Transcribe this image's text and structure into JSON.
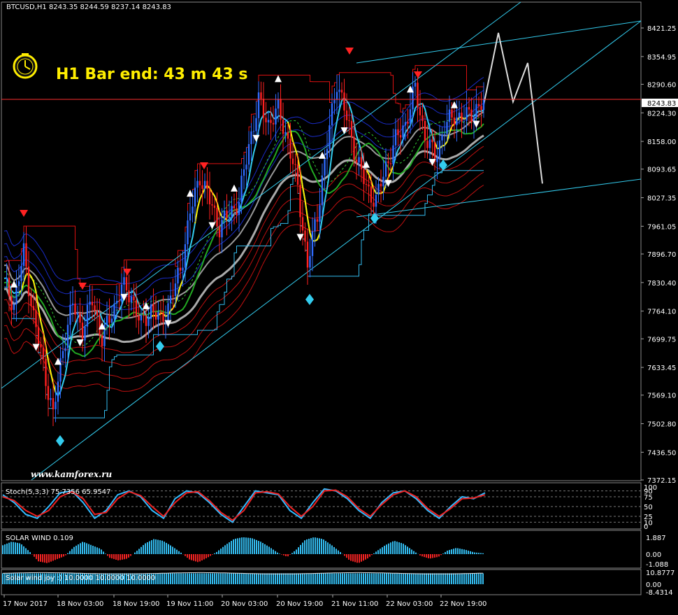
{
  "symbol_header": "BTCUSD,H1  8243.35 8244.59 8237.14 8243.83",
  "timer_text": "H1 Bar end: 43 m 43 s",
  "watermark": "www.kamforex.ru",
  "current_price_label": "8243.83",
  "colors": {
    "background": "#000000",
    "bull": "#2f6bff",
    "bear": "#ff2020",
    "yellow": "#ffee00",
    "cyan": "#33ccee",
    "grid": "#555555"
  },
  "price_axis": [
    "8421.25",
    "8354.95",
    "8290.60",
    "8224.30",
    "8158.00",
    "8093.65",
    "8027.35",
    "7961.05",
    "7896.70",
    "7830.40",
    "7764.10",
    "7699.75",
    "7633.45",
    "7569.10",
    "7502.80",
    "7436.50",
    "7372.15"
  ],
  "time_axis": [
    "17 Nov 2017",
    "18 Nov 03:00",
    "18 Nov 19:00",
    "19 Nov 11:00",
    "20 Nov 03:00",
    "20 Nov 19:00",
    "21 Nov 11:00",
    "22 Nov 03:00",
    "22 Nov 19:00"
  ],
  "stoch": {
    "label": "Stoch(5,3,3) 75.7356 65.9547",
    "levels": [
      "100",
      "90",
      "75",
      "50",
      "25",
      "10",
      "0"
    ]
  },
  "solar": {
    "label": "SOLAR WIND 0.109",
    "levels": [
      "1.887",
      "0.00",
      "-1.088"
    ]
  },
  "joy": {
    "label": "Solar wind joy :) 10.0000 10.0000 10.0000",
    "levels": [
      "10.8777",
      "0.00",
      "-8.4314"
    ]
  },
  "chart_data": {
    "type": "candlestick",
    "symbol": "BTCUSD",
    "timeframe": "H1",
    "ohlc_last": {
      "open": 8243.35,
      "high": 8244.59,
      "low": 8237.14,
      "close": 8243.83
    },
    "ylim": [
      7372.15,
      8421.25
    ],
    "close_path": [
      [
        0,
        7830
      ],
      [
        4,
        7780
      ],
      [
        8,
        7900
      ],
      [
        12,
        7750
      ],
      [
        16,
        7640
      ],
      [
        20,
        7520
      ],
      [
        24,
        7680
      ],
      [
        28,
        7780
      ],
      [
        32,
        7720
      ],
      [
        36,
        7790
      ],
      [
        40,
        7700
      ],
      [
        44,
        7760
      ],
      [
        48,
        7820
      ],
      [
        52,
        7800
      ],
      [
        56,
        7730
      ],
      [
        60,
        7770
      ],
      [
        64,
        7740
      ],
      [
        68,
        7790
      ],
      [
        72,
        7860
      ],
      [
        76,
        7990
      ],
      [
        80,
        8080
      ],
      [
        84,
        8020
      ],
      [
        88,
        7960
      ],
      [
        92,
        7990
      ],
      [
        96,
        8020
      ],
      [
        100,
        8150
      ],
      [
        104,
        8250
      ],
      [
        108,
        8200
      ],
      [
        112,
        8230
      ],
      [
        116,
        8160
      ],
      [
        120,
        8050
      ],
      [
        124,
        7870
      ],
      [
        128,
        7990
      ],
      [
        132,
        8150
      ],
      [
        136,
        8300
      ],
      [
        140,
        8210
      ],
      [
        144,
        8120
      ],
      [
        148,
        8050
      ],
      [
        152,
        8020
      ],
      [
        156,
        8100
      ],
      [
        160,
        8160
      ],
      [
        164,
        8200
      ],
      [
        168,
        8280
      ],
      [
        172,
        8170
      ],
      [
        176,
        8120
      ],
      [
        180,
        8190
      ],
      [
        184,
        8220
      ],
      [
        188,
        8210
      ],
      [
        192,
        8230
      ],
      [
        196,
        8243
      ]
    ],
    "forecast_path": [
      [
        196,
        8243
      ],
      [
        202,
        8410
      ],
      [
        208,
        8250
      ],
      [
        214,
        8340
      ],
      [
        220,
        8060
      ]
    ],
    "stoch_k": [
      80,
      60,
      30,
      20,
      50,
      85,
      90,
      60,
      20,
      40,
      80,
      90,
      75,
      40,
      20,
      70,
      90,
      85,
      60,
      30,
      10,
      50,
      90,
      85,
      80,
      40,
      20,
      60,
      95,
      90,
      70,
      40,
      20,
      60,
      85,
      90,
      70,
      40,
      20,
      50,
      75,
      70,
      85
    ],
    "stoch_d": [
      75,
      65,
      40,
      25,
      40,
      75,
      88,
      70,
      30,
      35,
      70,
      88,
      78,
      50,
      25,
      60,
      85,
      88,
      65,
      35,
      15,
      40,
      85,
      88,
      82,
      50,
      25,
      50,
      90,
      92,
      75,
      45,
      25,
      55,
      80,
      90,
      75,
      45,
      25,
      45,
      70,
      72,
      80
    ],
    "solar_wind": [
      1.0,
      1.4,
      1.2,
      0.3,
      -0.8,
      -1.0,
      -0.6,
      -0.2,
      0.8,
      1.4,
      1.0,
      0.6,
      -0.4,
      -0.7,
      -0.5,
      0.3,
      1.2,
      1.7,
      1.5,
      0.9,
      0.2,
      -0.6,
      -0.9,
      -0.4,
      0.2,
      1.0,
      1.7,
      1.9,
      1.8,
      1.4,
      0.8,
      0.1,
      -0.3,
      0.5,
      1.6,
      1.9,
      1.7,
      1.0,
      0.2,
      -0.7,
      -1.0,
      -0.5,
      0.3,
      1.0,
      1.5,
      1.2,
      0.5,
      -0.2,
      -0.5,
      -0.3,
      0.4,
      0.7,
      0.5,
      0.2,
      0.1
    ]
  }
}
